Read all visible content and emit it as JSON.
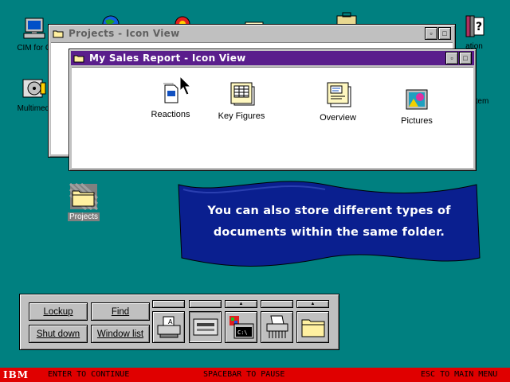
{
  "desktop": {
    "icons": [
      {
        "label": "CIM for O",
        "icon": "cim-computer-icon"
      },
      {
        "label": "Multimedi",
        "icon": "multimedia-icon"
      },
      {
        "label": "Projects",
        "icon": "projects-folder-icon"
      },
      {
        "label": "ation",
        "icon": "information-icon"
      },
      {
        "label": "tem",
        "icon": "system-icon"
      }
    ]
  },
  "windows": {
    "projects": {
      "title": "Projects - Icon View"
    },
    "sales": {
      "title": "My Sales Report - Icon View",
      "items": [
        {
          "label": "Reactions",
          "icon": "document-icon"
        },
        {
          "label": "Key Figures",
          "icon": "spreadsheet-icon"
        },
        {
          "label": "Overview",
          "icon": "presentation-icon"
        },
        {
          "label": "Pictures",
          "icon": "pictures-icon"
        }
      ]
    }
  },
  "banner": {
    "line1": "You can also store different types of",
    "line2": "documents within the same folder."
  },
  "launchpad": {
    "buttons": {
      "lockup": "Lockup",
      "find": "Find",
      "shutdown": "Shut down",
      "windowlist": "Window list"
    },
    "tab_arrow": "▲",
    "objects": [
      "printer-icon",
      "drive-icon",
      "os2-window-icon",
      "shredder-icon",
      "folder-icon"
    ]
  },
  "statusbar": {
    "logo": "IBM",
    "left": "ENTER TO CONTINUE",
    "center": "SPACEBAR TO PAUSE",
    "right": "ESC TO MAIN MENU"
  },
  "colors": {
    "desktop": "#008080",
    "active_titlebar": "#5a1e8c",
    "banner": "#0a1f8f",
    "statusbar": "#e00000"
  }
}
